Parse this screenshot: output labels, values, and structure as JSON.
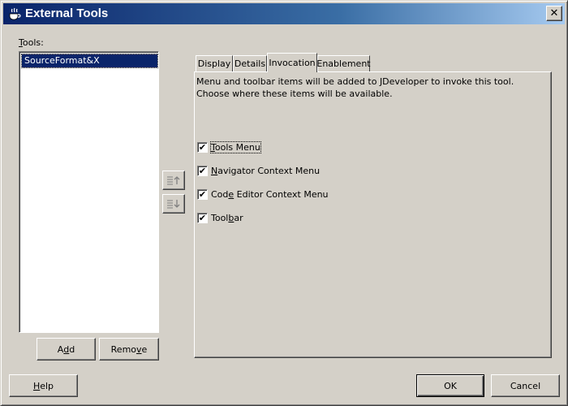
{
  "window": {
    "title": "External Tools",
    "close_label": "✕"
  },
  "tools": {
    "label_prefix": "",
    "label_accel": "T",
    "label_rest": "ools:",
    "items": [
      "SourceFormat&X"
    ]
  },
  "buttons": {
    "add_pre": "A",
    "add_accel": "d",
    "add_post": "d",
    "remove_pre": "Remo",
    "remove_accel": "v",
    "remove_post": "e",
    "help_pre": "",
    "help_accel": "H",
    "help_post": "elp",
    "ok": "OK",
    "cancel": "Cancel"
  },
  "reorder": {
    "move_up_icon": "move-up-icon",
    "move_down_icon": "move-down-icon"
  },
  "tabs": [
    {
      "label": "Display"
    },
    {
      "label": "Details"
    },
    {
      "label": "Invocation"
    },
    {
      "label": "Enablement"
    }
  ],
  "invocation": {
    "description": "Menu and toolbar items will be added to JDeveloper to invoke this tool. Choose where these items will be available.",
    "options": [
      {
        "pre": "",
        "accel": "T",
        "post": "ools Menu",
        "checked": true
      },
      {
        "pre": "",
        "accel": "N",
        "post": "avigator Context Menu",
        "checked": true
      },
      {
        "pre": "Cod",
        "accel": "e",
        "post": " Editor Context Menu",
        "checked": true
      },
      {
        "pre": "Tool",
        "accel": "b",
        "post": "ar",
        "checked": true
      }
    ],
    "check_glyph": "✔"
  }
}
